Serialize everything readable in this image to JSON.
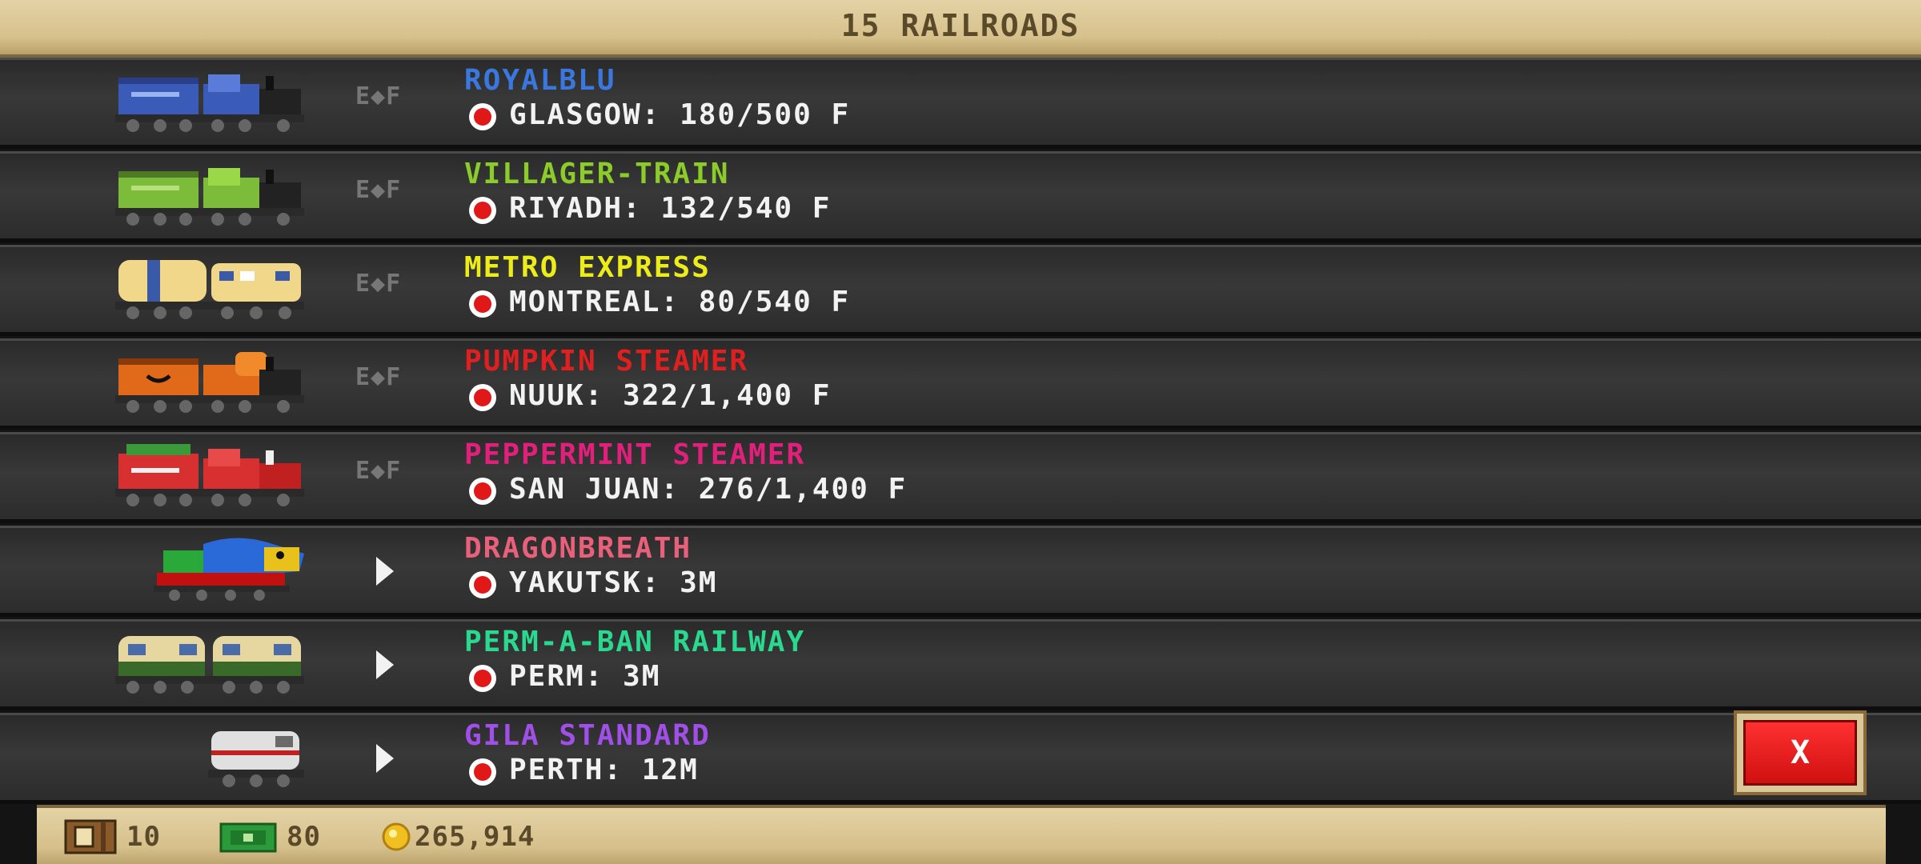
{
  "header": {
    "title": "15 RAILROADS"
  },
  "rows": [
    {
      "name": "ROYALBLU",
      "station": "GLASGOW: 180/500 F",
      "name_color": "#3a78e0",
      "action": "E◆F",
      "train": "blue-steam-train",
      "body": "#3a5cb8",
      "accent": "#2a3f8a"
    },
    {
      "name": "VILLAGER-TRAIN",
      "station": "RIYADH: 132/540 F",
      "name_color": "#8ccc2a",
      "action": "E◆F",
      "train": "green-steam-train",
      "body": "#7cbc3a",
      "accent": "#4d7a22"
    },
    {
      "name": "METRO EXPRESS",
      "station": "MONTREAL: 80/540 F",
      "name_color": "#ecec1a",
      "action": "E◆F",
      "train": "metro-diesel-train",
      "body": "#f0d78a",
      "accent": "#3a5aa8"
    },
    {
      "name": "PUMPKIN STEAMER",
      "station": "NUUK: 322/1,400 F",
      "name_color": "#e02020",
      "action": "E◆F",
      "train": "pumpkin-steam-train",
      "body": "#e06a1a",
      "accent": "#8a3a0a"
    },
    {
      "name": "PEPPERMINT STEAMER",
      "station": "SAN JUAN: 276/1,400 F",
      "name_color": "#e0207a",
      "action": "E◆F",
      "train": "peppermint-steam-train",
      "body": "#d83030",
      "accent": "#f0f0f0"
    },
    {
      "name": "DRAGONBREATH",
      "station": "YAKUTSK: 3M",
      "name_color": "#e8607a",
      "action": "play",
      "train": "dragon-train",
      "body": "#2aa83a",
      "accent": "#c01010"
    },
    {
      "name": "PERM-A-BAN RAILWAY",
      "station": "PERM: 3M",
      "name_color": "#2ad890",
      "action": "play",
      "train": "perm-diesel-train",
      "body": "#e6d7a0",
      "accent": "#3a6a2a"
    },
    {
      "name": "GILA STANDARD",
      "station": "PERTH: 12M",
      "name_color": "#a050e8",
      "action": "play",
      "train": "gila-diesel-train",
      "body": "#e0e0e0",
      "accent": "#c02020"
    }
  ],
  "footer": {
    "crates": "10",
    "cash": "80",
    "coins": "265,914"
  },
  "close_button": {
    "label": "X"
  }
}
